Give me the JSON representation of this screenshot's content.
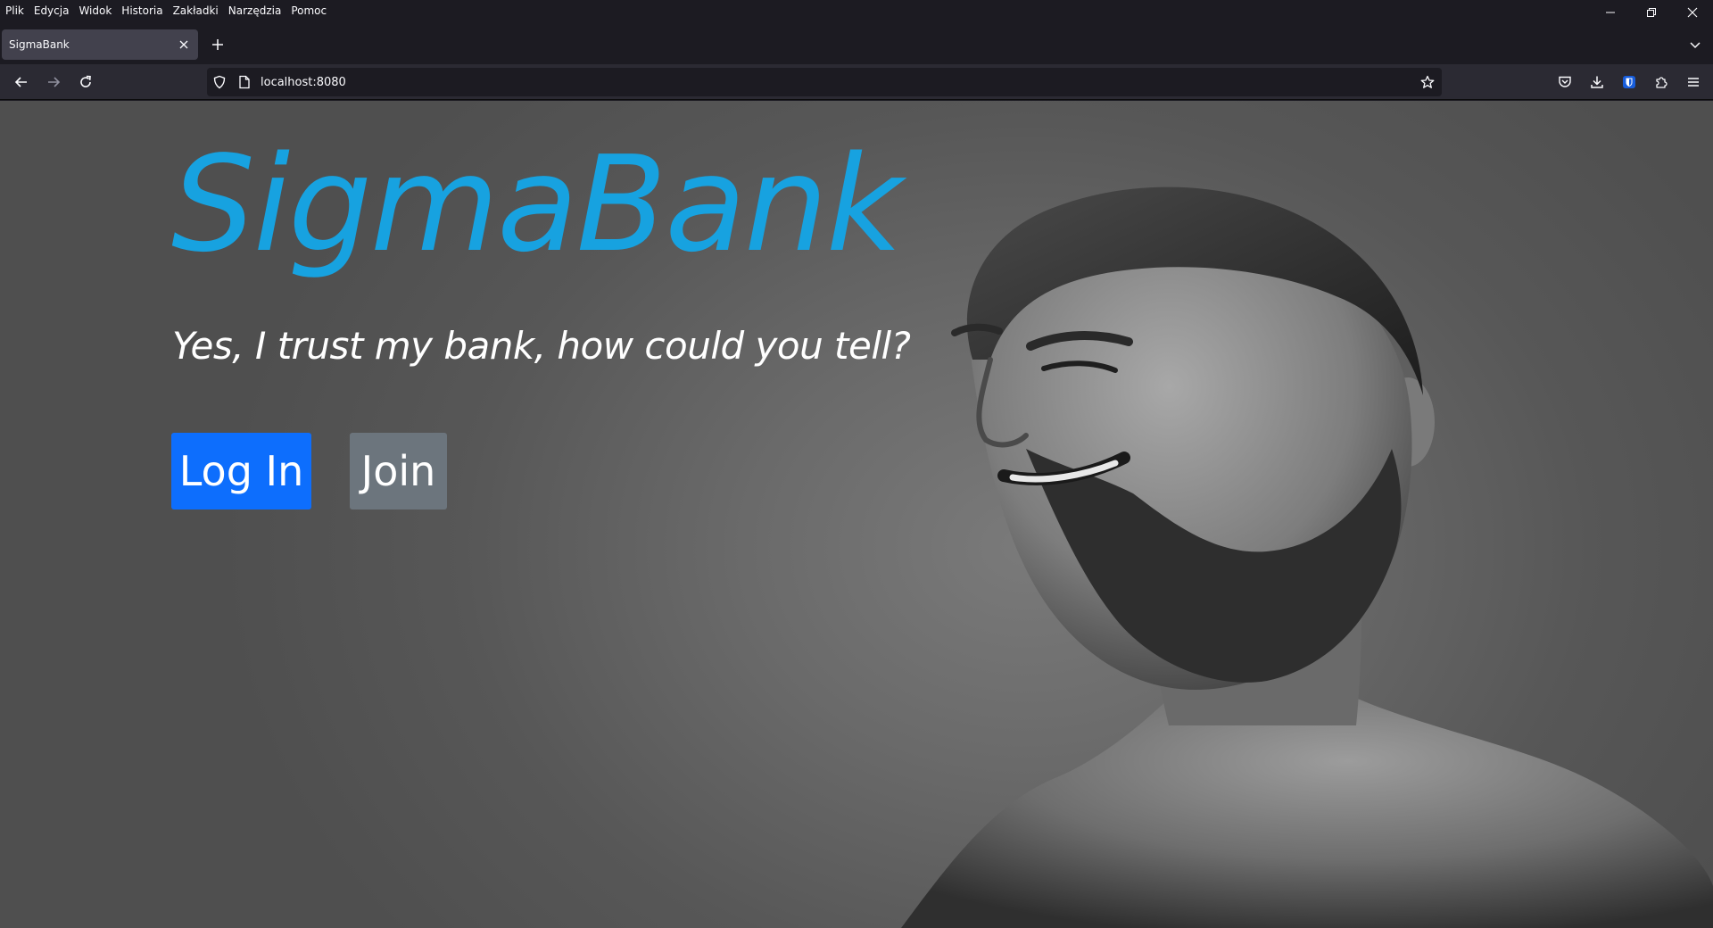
{
  "menubar": {
    "items": [
      "Plik",
      "Edycja",
      "Widok",
      "Historia",
      "Zakładki",
      "Narzędzia",
      "Pomoc"
    ]
  },
  "tab": {
    "title": "SigmaBank"
  },
  "navbar": {
    "url": "localhost:8080"
  },
  "page": {
    "brand": "SigmaBank",
    "tagline": "Yes, I trust my bank, how could you tell?",
    "login_label": "Log In",
    "join_label": "Join"
  },
  "colors": {
    "brand": "#17a2e0",
    "login_button": "#0d6efd",
    "join_button": "#6c757d",
    "chrome_dark": "#1c1b22",
    "toolbar": "#2b2a33"
  }
}
